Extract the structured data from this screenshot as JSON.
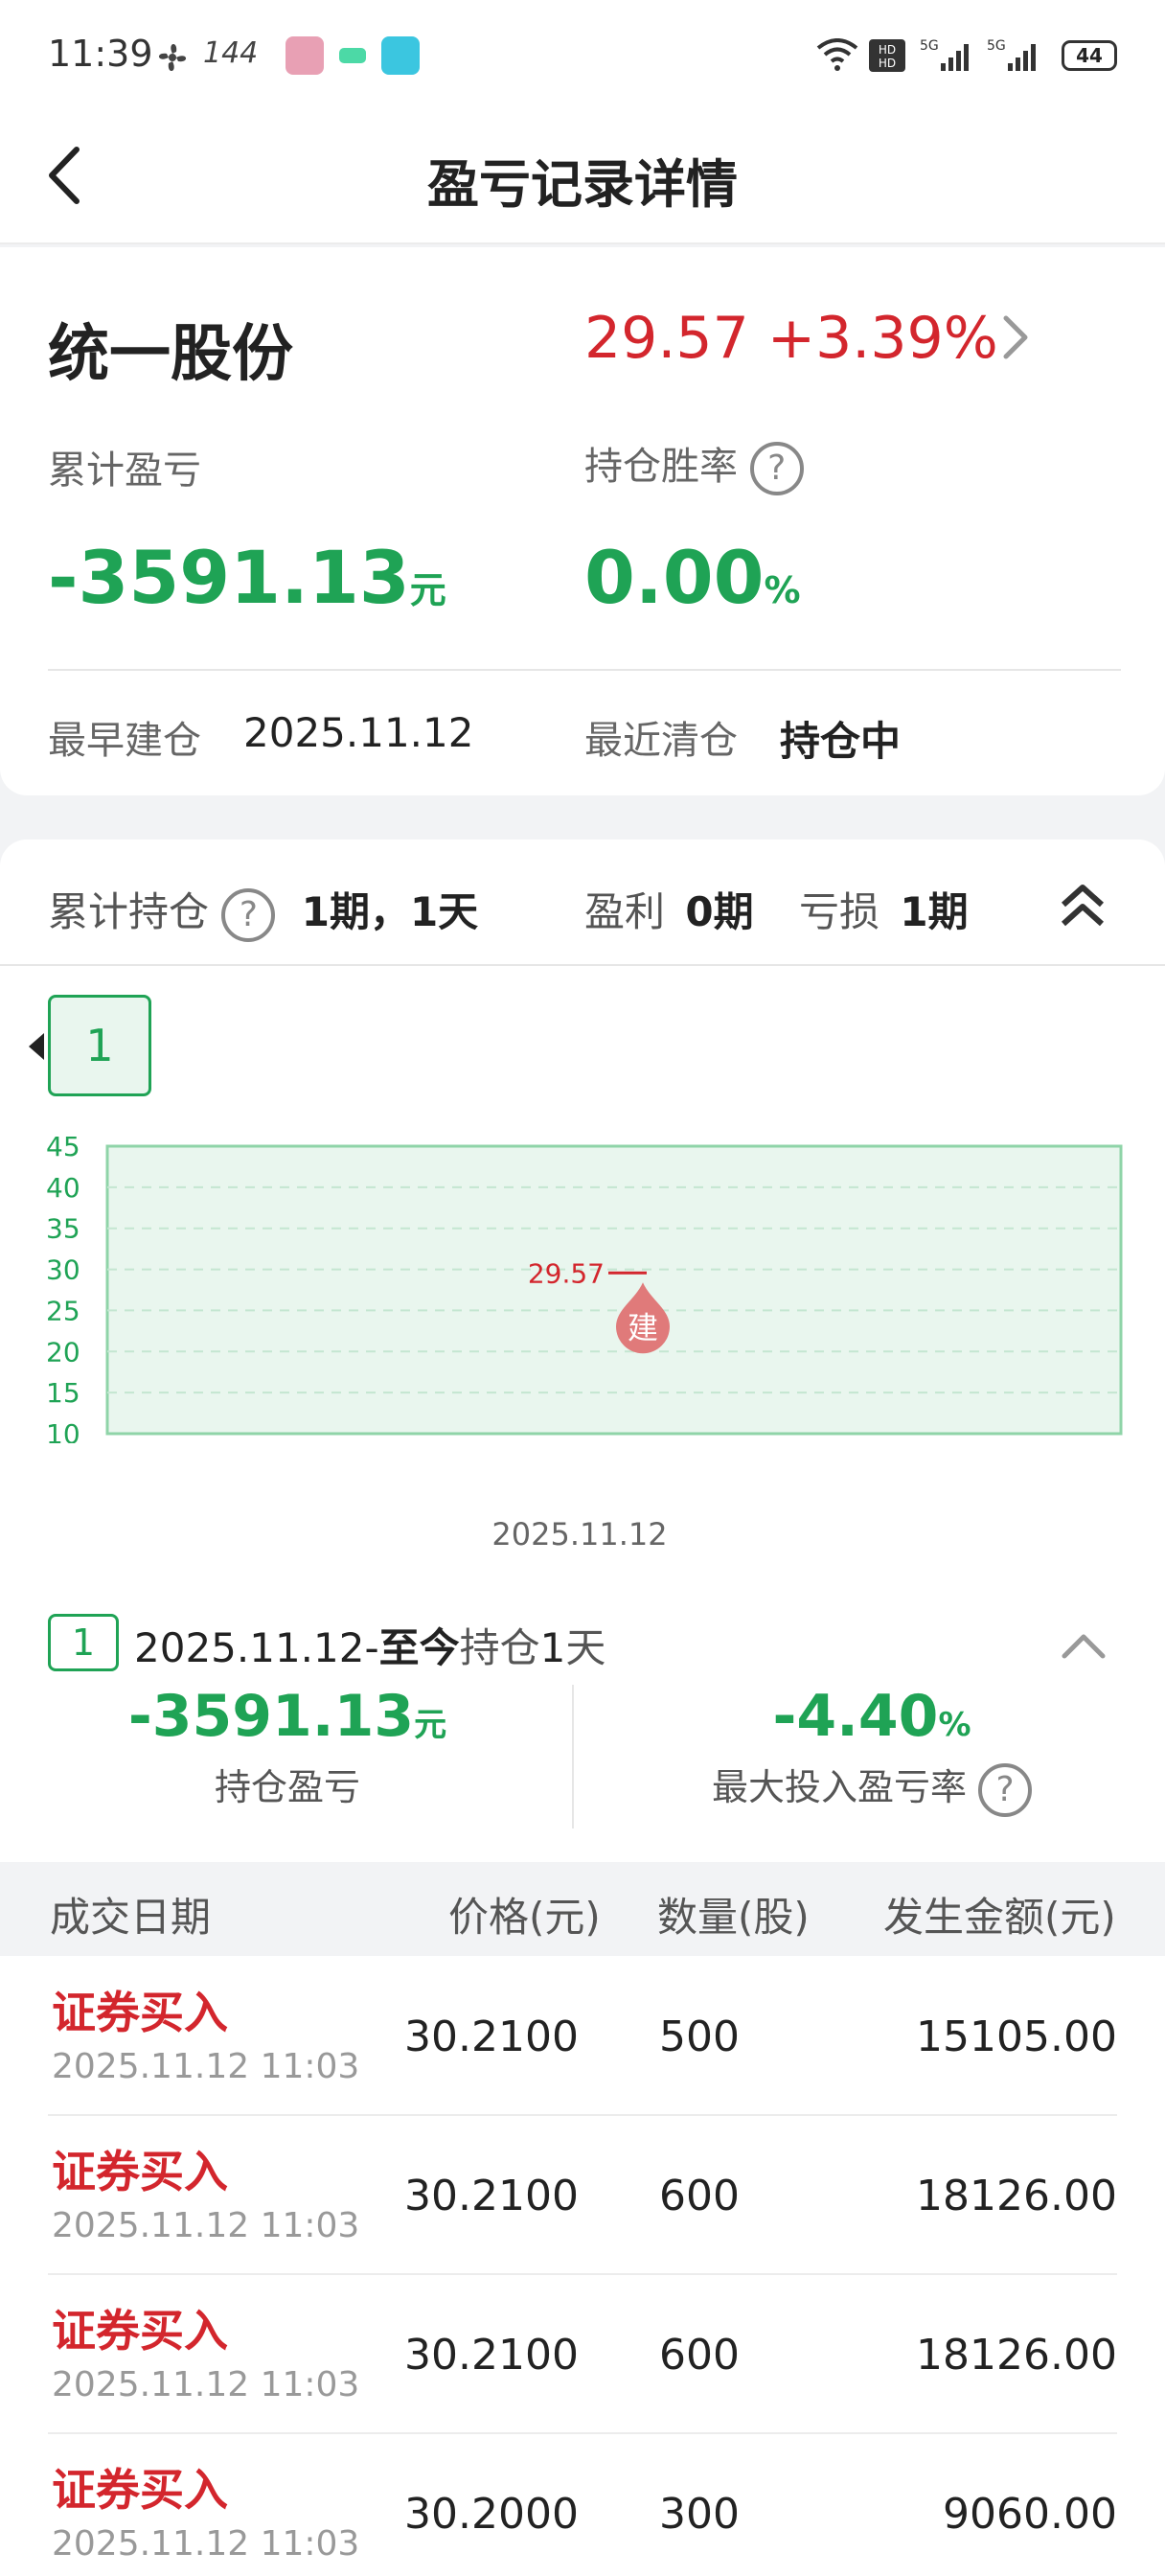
{
  "status_bar": {
    "time": "11:39",
    "refresh_rate": "144",
    "battery": "44"
  },
  "nav": {
    "title": "盈亏记录详情"
  },
  "stock": {
    "name": "统一股份",
    "price_change": "29.57 +3.39%"
  },
  "summary": {
    "cum_pl_label": "累计盈亏",
    "cum_pl_value": "-3591.13",
    "cum_pl_unit": "元",
    "win_rate_label": "持仓胜率",
    "win_rate_value": "0.00",
    "win_rate_unit": "%",
    "first_open_label": "最早建仓",
    "first_open_value": "2025.11.12",
    "last_close_label": "最近清仓",
    "last_close_value": "持仓中"
  },
  "holding": {
    "cum_hold_label": "累计持仓",
    "cum_hold_value": "1期，1天",
    "profit_label": "盈利",
    "profit_value": "0期",
    "loss_label": "亏损",
    "loss_value": "1期"
  },
  "period_tab": "1",
  "chart_data": {
    "type": "line",
    "y_ticks": [
      "45",
      "40",
      "35",
      "30",
      "25",
      "20",
      "15",
      "10"
    ],
    "ylim": [
      10,
      45
    ],
    "x_label_date": "2025.11.12",
    "price_marker_label": "29.57",
    "price_marker_value": 29.57,
    "build_marker_text": "建",
    "colors": {
      "axis": "#1fa355",
      "fill": "#e9f6ee",
      "marker": "#e07a7a",
      "price_label": "#d3262d"
    }
  },
  "period": {
    "badge": "1",
    "start": "2025.11.12-",
    "to_now": "至今",
    "hold_prefix": "持仓",
    "hold_days": "1",
    "hold_suffix": "天",
    "pl_value": "-3591.13",
    "pl_unit": "元",
    "pl_label": "持仓盈亏",
    "max_rate_value": "-4.40",
    "max_rate_unit": "%",
    "max_rate_label": "最大投入盈亏率"
  },
  "table": {
    "headers": [
      "成交日期",
      "价格(元)",
      "数量(股)",
      "发生金额(元)"
    ],
    "rows": [
      {
        "type": "证券买入",
        "time": "2025.11.12 11:03",
        "price": "30.2100",
        "qty": "500",
        "amount": "15105.00"
      },
      {
        "type": "证券买入",
        "time": "2025.11.12 11:03",
        "price": "30.2100",
        "qty": "600",
        "amount": "18126.00"
      },
      {
        "type": "证券买入",
        "time": "2025.11.12 11:03",
        "price": "30.2100",
        "qty": "600",
        "amount": "18126.00"
      },
      {
        "type": "证券买入",
        "time": "2025.11.12 11:03",
        "price": "30.2000",
        "qty": "300",
        "amount": "9060.00"
      }
    ]
  }
}
